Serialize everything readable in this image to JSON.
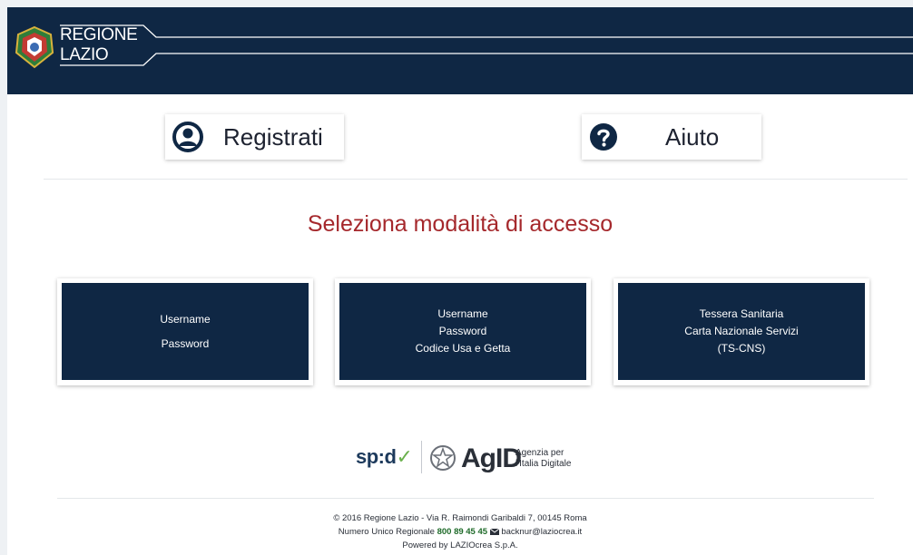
{
  "header": {
    "brand_line1": "REGIONE",
    "brand_line2": "LAZIO",
    "logo_icon": "regione-lazio-emblem-icon"
  },
  "top_buttons": {
    "registrati": {
      "label": "Registrati",
      "icon": "user-circle-icon"
    },
    "aiuto": {
      "label": "Aiuto",
      "icon": "question-circle-icon"
    }
  },
  "main": {
    "title": "Seleziona modalità di accesso",
    "title_color": "#a5282c",
    "cards": [
      {
        "lines": [
          "Username",
          "Password"
        ]
      },
      {
        "lines": [
          "Username",
          "Password",
          "Codice Usa e Getta"
        ]
      },
      {
        "lines": [
          "Tessera Sanitaria",
          "Carta Nazionale Servizi",
          "(TS-CNS)"
        ]
      }
    ]
  },
  "logos": {
    "spid_text": "sp:d",
    "spid_check": "✓",
    "agid_name": "AgID",
    "agid_sub_line1": "Agenzia per",
    "agid_sub_line2": "l'Italia Digitale"
  },
  "footer": {
    "line1": "© 2016 Regione Lazio - Via R. Raimondi Garibaldi 7, 00145 Roma",
    "phone_label": "Numero Unico Regionale",
    "phone": "800 89 45 45",
    "email": "backnur@laziocrea.it",
    "line3": "Powered by LAZIOcrea S.p.A."
  },
  "colors": {
    "header_bg": "#0f2744",
    "card_bg": "#0f2744",
    "phone_color": "#1f6b2a"
  }
}
